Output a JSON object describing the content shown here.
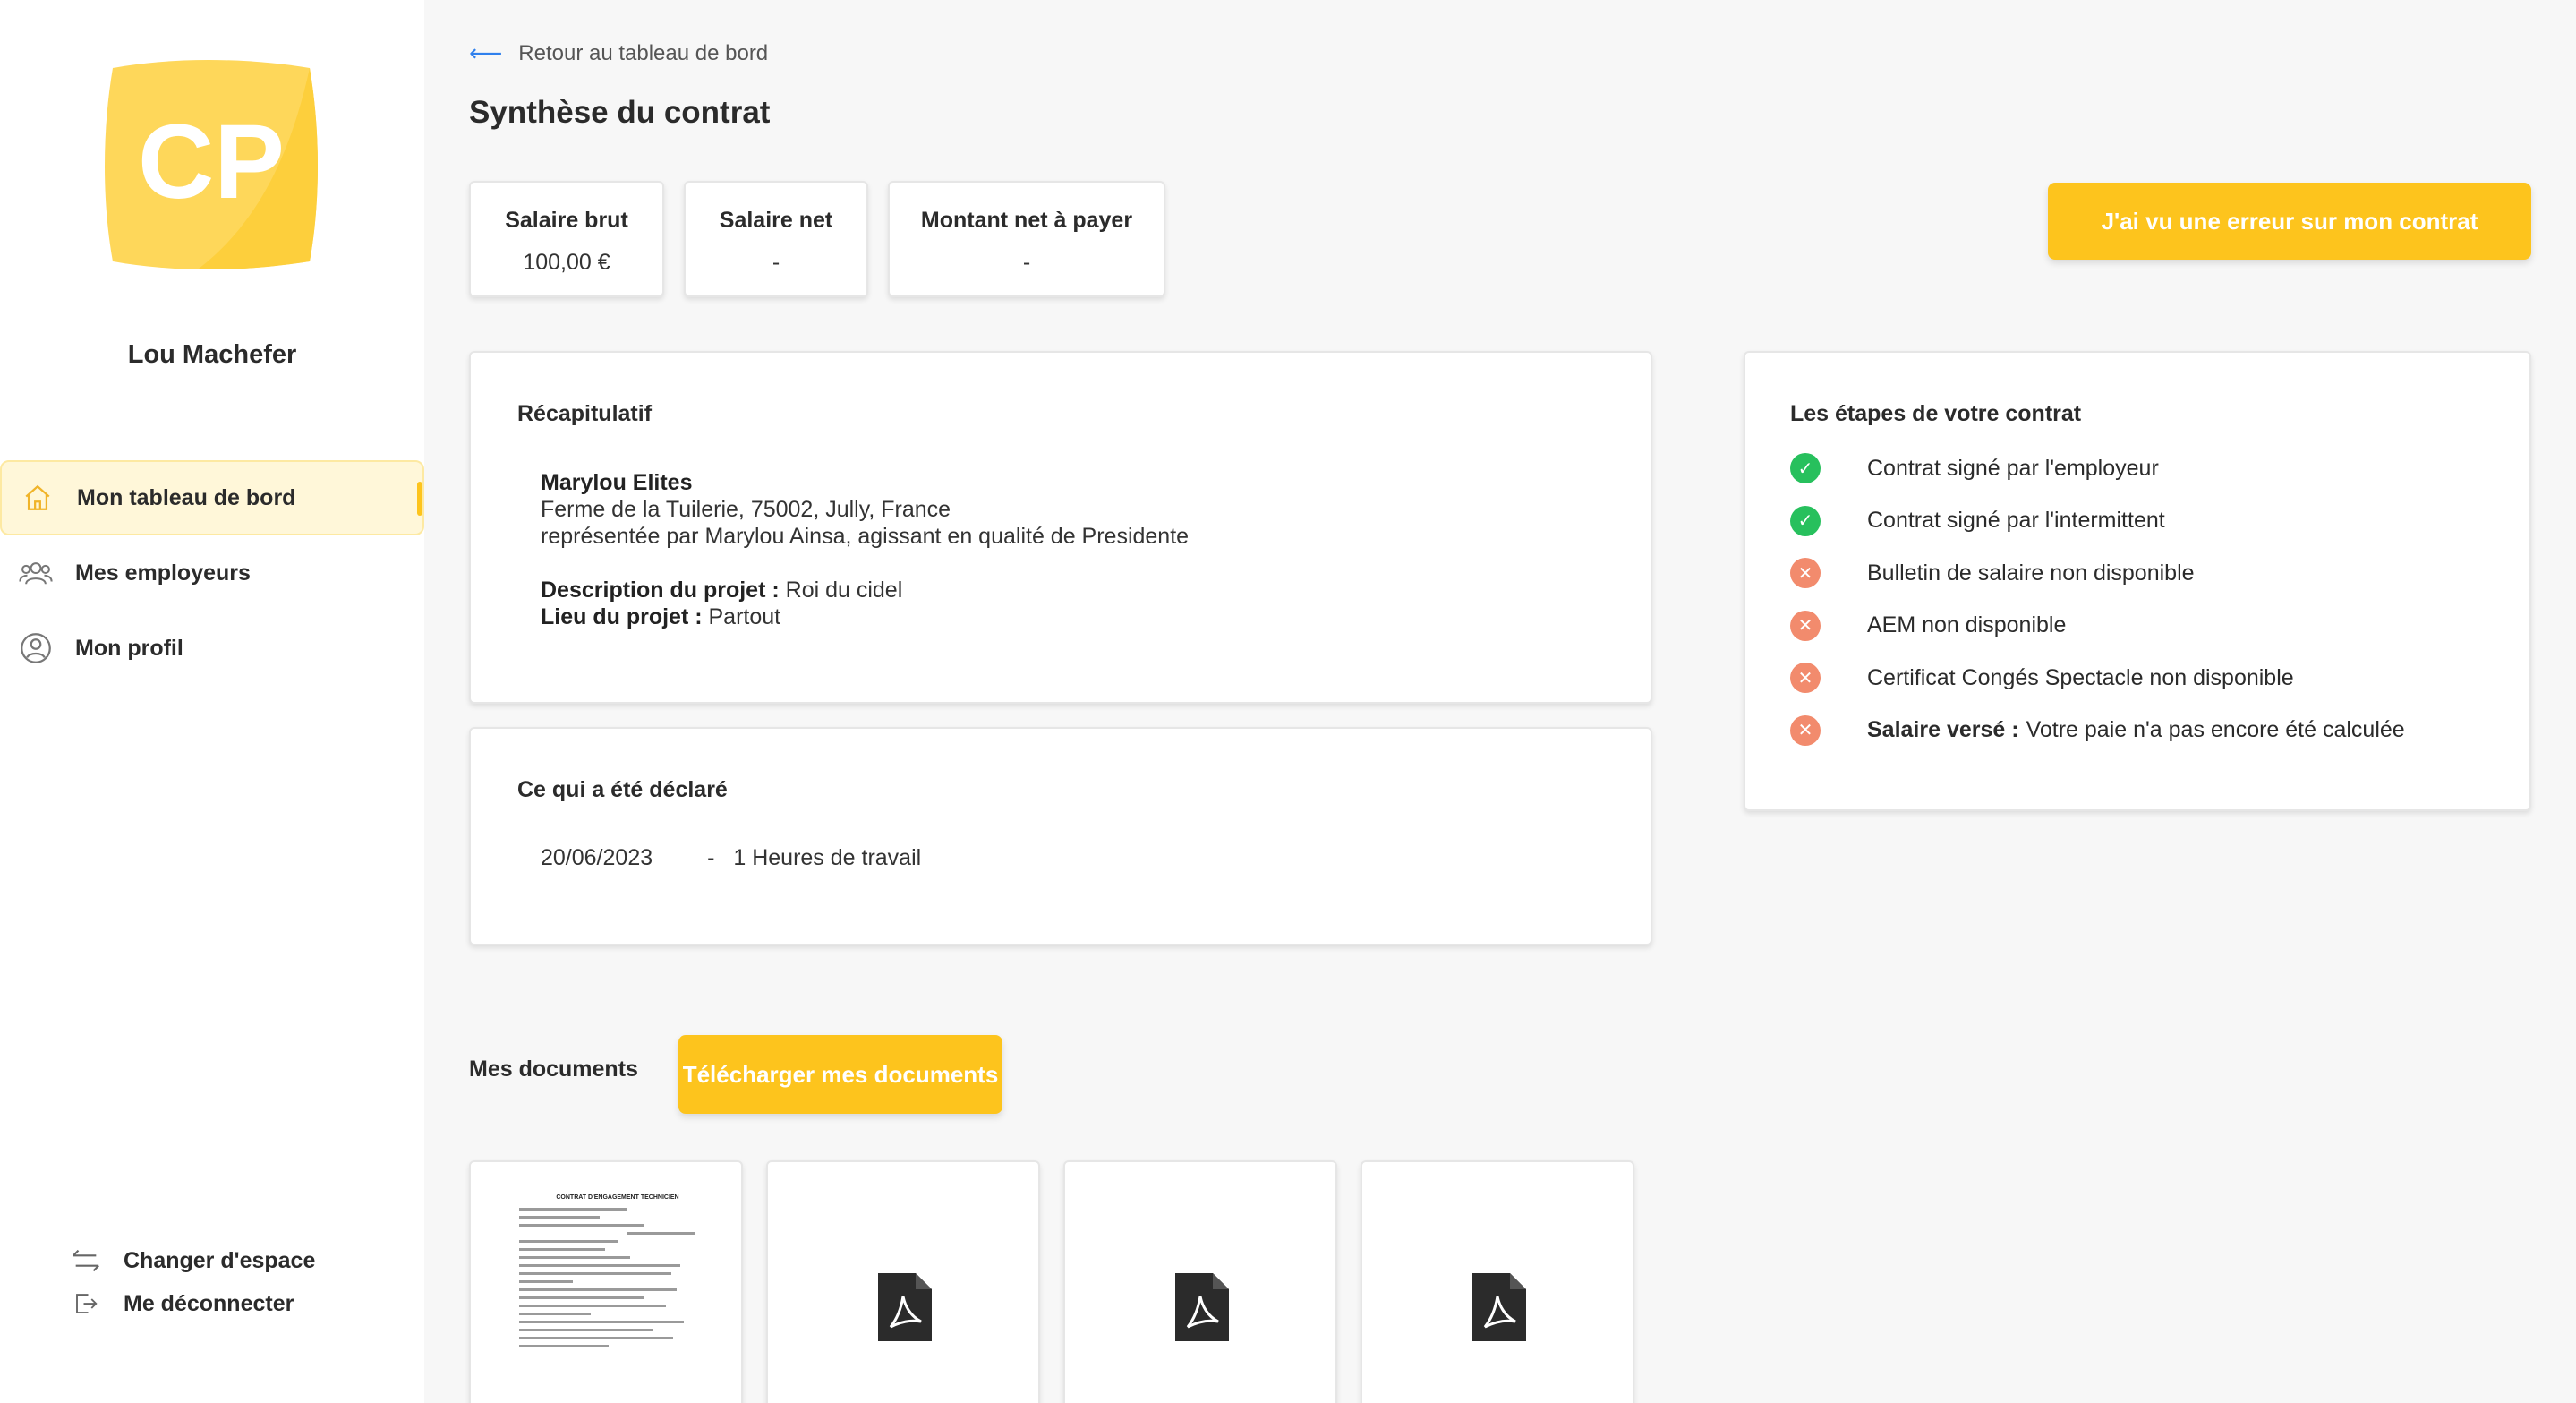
{
  "sidebar": {
    "logo_text": "CP",
    "user_name": "Lou Machefer",
    "nav": [
      {
        "label": "Mon tableau de bord",
        "icon": "home-icon",
        "active": true
      },
      {
        "label": "Mes employeurs",
        "icon": "users-icon",
        "active": false
      },
      {
        "label": "Mon profil",
        "icon": "user-circle-icon",
        "active": false
      }
    ],
    "bottom": [
      {
        "label": "Changer d'espace",
        "icon": "switch-arrows-icon"
      },
      {
        "label": "Me déconnecter",
        "icon": "logout-icon"
      }
    ]
  },
  "header": {
    "back_label": "Retour au tableau de bord",
    "title": "Synthèse du contrat"
  },
  "stats": [
    {
      "label": "Salaire brut",
      "value": "100,00 €"
    },
    {
      "label": "Salaire net",
      "value": "-"
    },
    {
      "label": "Montant net à payer",
      "value": "-"
    }
  ],
  "error_button": "J'ai vu une erreur sur mon contrat",
  "recap": {
    "title": "Récapitulatif",
    "company": "Marylou Elites",
    "address": "Ferme de la Tuilerie, 75002, Jully, France",
    "represented": "représentée par Marylou Ainsa, agissant en qualité de Presidente",
    "project_label": "Description du projet :",
    "project_value": "Roi du cidel",
    "place_label": "Lieu du projet :",
    "place_value": "Partout"
  },
  "declared": {
    "title": "Ce qui a été déclaré",
    "date": "20/06/2023",
    "sep": "-",
    "detail": "1 Heures de travail"
  },
  "steps": {
    "title": "Les étapes de votre contrat",
    "items": [
      {
        "status": "ok",
        "label": "Contrat signé par l'employeur",
        "extra": ""
      },
      {
        "status": "ok",
        "label": "Contrat signé par l'intermittent",
        "extra": ""
      },
      {
        "status": "ko",
        "label": "Bulletin de salaire non disponible",
        "extra": ""
      },
      {
        "status": "ko",
        "label": "AEM non disponible",
        "extra": ""
      },
      {
        "status": "ko",
        "label": "Certificat Congés Spectacle non disponible",
        "extra": ""
      },
      {
        "status": "ko",
        "label": "Salaire versé :",
        "extra": "Votre paie n'a pas encore été calculée"
      }
    ]
  },
  "documents": {
    "label": "Mes documents",
    "download_button": "Télécharger mes documents",
    "thumb_title": "CONTRAT D'ENGAGEMENT TECHNICIEN"
  },
  "colors": {
    "accent": "#fdc41d",
    "ok": "#27c05d",
    "ko": "#f28b6d",
    "link": "#2f80ed"
  }
}
